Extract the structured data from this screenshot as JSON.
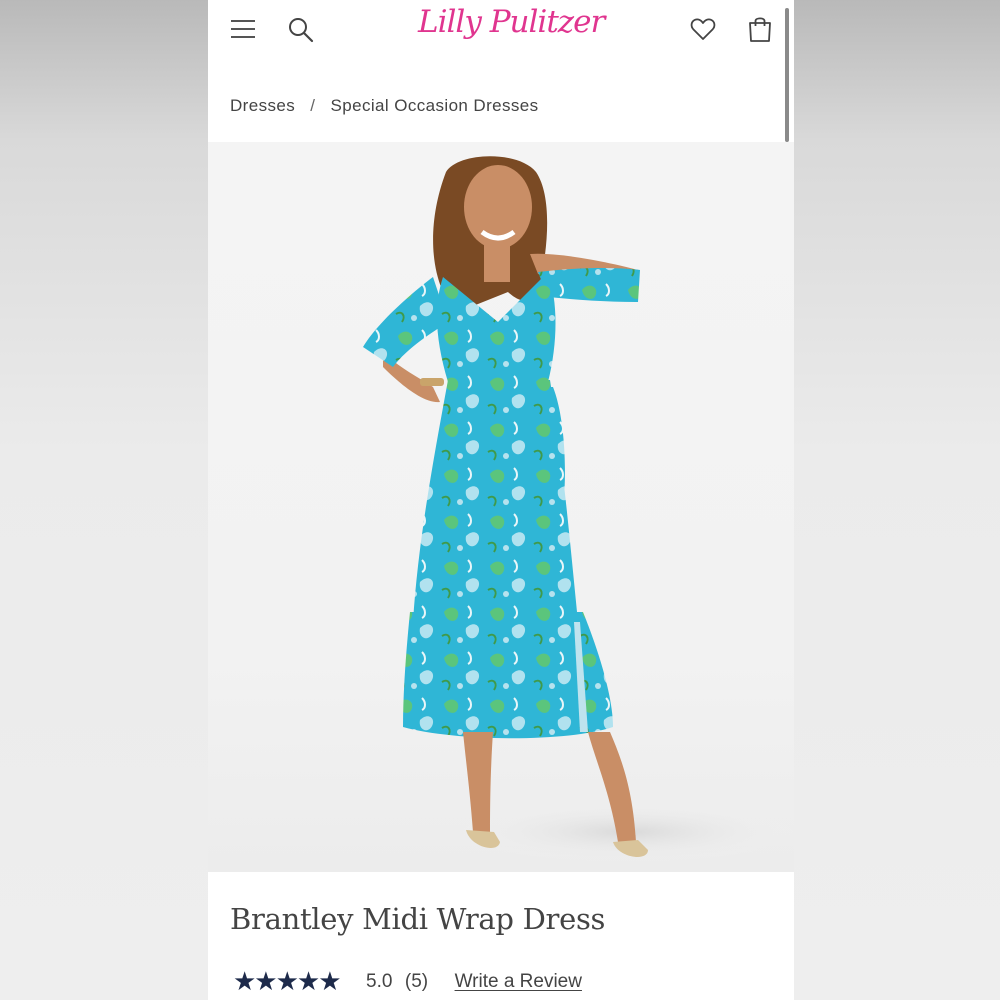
{
  "brand": {
    "logo_text": "Lilly Pulitzer",
    "logo_color": "#e0358f"
  },
  "header": {
    "menu_icon": "hamburger-menu-icon",
    "search_icon": "search-icon",
    "wishlist_icon": "heart-icon",
    "bag_icon": "shopping-bag-icon"
  },
  "breadcrumb": {
    "items": [
      "Dresses",
      "Special Occasion Dresses"
    ],
    "separator": "/"
  },
  "product": {
    "image_alt": "Model wearing blue floral midi wrap dress",
    "title": "Brantley Midi Wrap Dress",
    "rating": {
      "stars": "★★★★★",
      "score": "5.0",
      "count": "(5)",
      "value": 5.0,
      "max": 5
    },
    "write_review_label": "Write a Review"
  },
  "colors": {
    "star": "#1d2a4a",
    "dress_primary": "#2fb6d6",
    "dress_accent": "#5cc46a",
    "text": "#444444"
  }
}
